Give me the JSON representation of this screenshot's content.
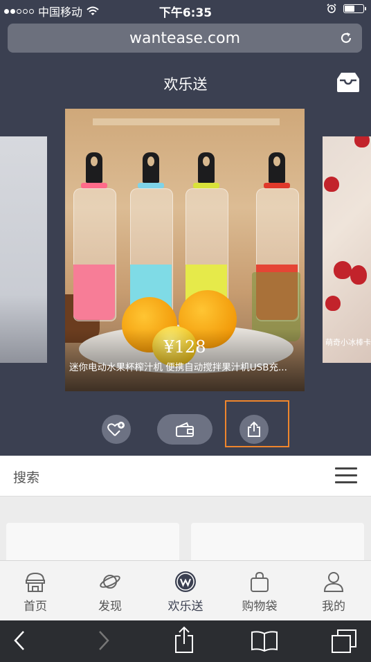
{
  "status": {
    "carrier": "中国移动",
    "time": "下午6:35"
  },
  "browser": {
    "url": "wantease.com"
  },
  "hero": {
    "title": "欢乐送",
    "card": {
      "price": "¥128",
      "description": "迷你电动水果杯榨汁机 便携自动搅拌果汁机USB充..."
    },
    "right_card_caption": "萌奇小冰棒卡"
  },
  "search": {
    "label": "搜索"
  },
  "tabs": [
    {
      "label": "首页",
      "icon": "home-icon"
    },
    {
      "label": "发现",
      "icon": "planet-icon"
    },
    {
      "label": "欢乐送",
      "icon": "w-logo-icon"
    },
    {
      "label": "购物袋",
      "icon": "shopping-bag-icon"
    },
    {
      "label": "我的",
      "icon": "person-icon"
    }
  ],
  "colors": {
    "header_bg": "#3b4051",
    "action_bg": "#6d7283",
    "highlight": "#f0862c",
    "tab_bg": "#f3f3f3",
    "toolbar_bg": "#2b2d31"
  }
}
